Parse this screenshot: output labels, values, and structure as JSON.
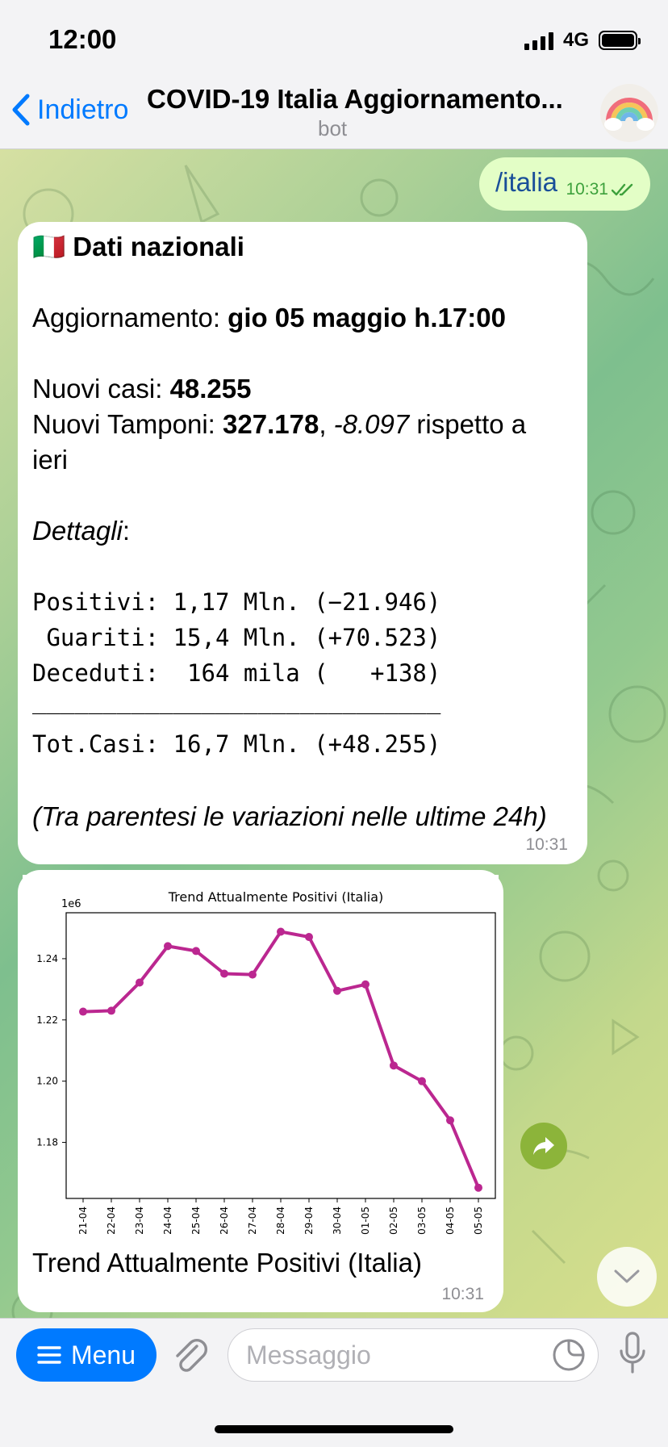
{
  "status_bar": {
    "time": "12:00",
    "network": "4G"
  },
  "nav": {
    "back_label": "Indietro",
    "title": "COVID-19 Italia Aggiornamento...",
    "subtitle": "bot"
  },
  "outgoing": {
    "text": "/italia",
    "time": "10:31"
  },
  "message1": {
    "flag": "🇮🇹",
    "heading": "Dati nazionali",
    "update_label": "Aggiornamento: ",
    "update_value": "gio 05 maggio h.17:00",
    "new_cases_label": "Nuovi casi: ",
    "new_cases_value": "48.255",
    "new_tests_label": "Nuovi Tamponi: ",
    "new_tests_value": "327.178",
    "new_tests_sep": ", ",
    "new_tests_delta": "-8.097",
    "new_tests_suffix": " rispetto a",
    "new_tests_suffix2": "ieri",
    "details_label": "Dettagli",
    "details_colon": ":",
    "mono_lines": [
      "Positivi: 1,17 Mln. (−21.946)",
      " Guariti: 15,4 Mln. (+70.523)",
      "Deceduti:  164 mila (   +138)",
      "_____________________________",
      "Tot.Casi: 16,7 Mln. (+48.255)"
    ],
    "footnote": "(Tra parentesi le variazioni nelle ultime 24h)",
    "time": "10:31"
  },
  "message2": {
    "caption": "Trend Attualmente Positivi (Italia)",
    "time": "10:31"
  },
  "chart_data": {
    "type": "line",
    "title": "Trend Attualmente Positivi (Italia)",
    "offset_label": "1e6",
    "categories": [
      "21-04",
      "22-04",
      "23-04",
      "24-04",
      "25-04",
      "26-04",
      "27-04",
      "28-04",
      "29-04",
      "30-04",
      "01-05",
      "02-05",
      "03-05",
      "04-05",
      "05-05"
    ],
    "values": [
      1.2227,
      1.223,
      1.2322,
      1.2441,
      1.2425,
      1.2351,
      1.2348,
      1.2488,
      1.2471,
      1.2295,
      1.2316,
      1.2051,
      1.2,
      1.1872,
      1.1652
    ],
    "yticks": [
      1.18,
      1.2,
      1.22,
      1.24
    ],
    "ylim": [
      1.1617,
      1.255
    ],
    "color": "#bb2790",
    "grid": false
  },
  "input": {
    "menu_label": "Menu",
    "placeholder": "Messaggio"
  },
  "colors": {
    "accent": "#007aff",
    "outgoing_bubble": "#e3fec6",
    "check": "#3da13c"
  }
}
